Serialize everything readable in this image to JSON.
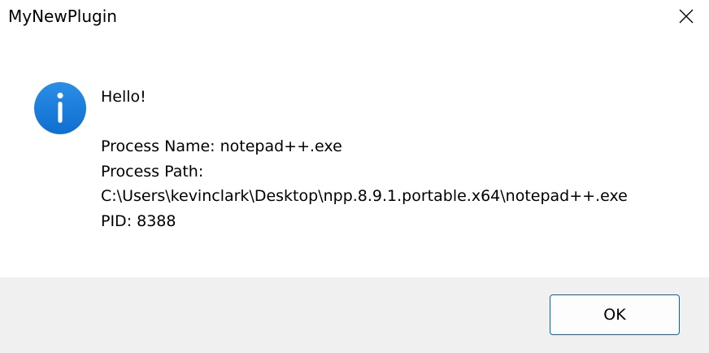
{
  "window": {
    "title": "MyNewPlugin",
    "close_icon": "close-icon"
  },
  "message": {
    "icon": "info-icon",
    "greeting": "Hello!",
    "process_name": "Process Name: notepad++.exe",
    "process_path_label": "Process Path:",
    "process_path_value": "C:\\Users\\kevinclark\\Desktop\\npp.8.9.1.portable.x64\\notepad++.exe",
    "pid": "PID: 8388"
  },
  "buttons": {
    "ok_label": "OK"
  },
  "colors": {
    "icon_blue": "#1a7fdc",
    "footer_bg": "#f0f0f0",
    "button_border": "#0067c0"
  }
}
